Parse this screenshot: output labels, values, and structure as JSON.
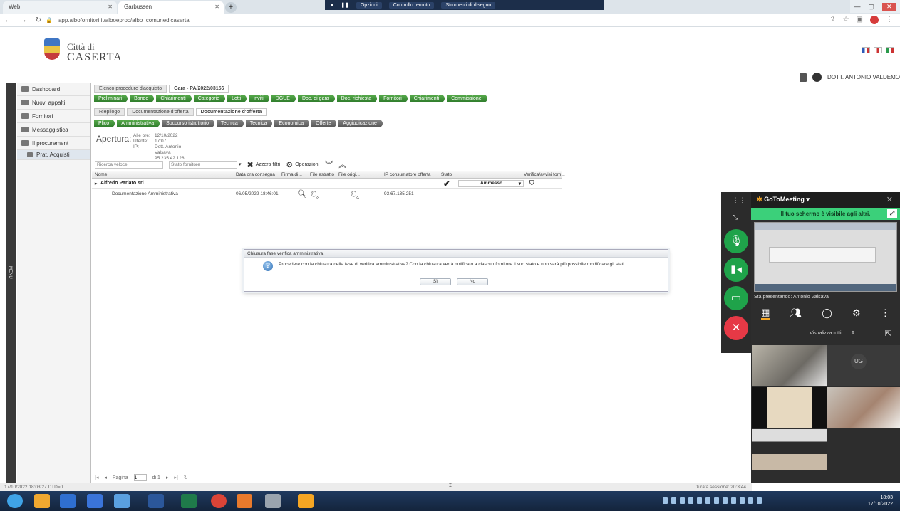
{
  "browser": {
    "tabs": [
      {
        "label": "Web"
      },
      {
        "label": "Garbussen"
      }
    ],
    "url": "app.albofornitori.it/alboeproc/albo_comunedicaserta",
    "screen_share_bar": {
      "options": "Opzioni",
      "remote_control": "Controllo remoto",
      "drawing_tools": "Strumenti di disegno"
    }
  },
  "header": {
    "brand_line1": "Città di",
    "brand_line2": "CASERTA",
    "user_name": "DOTT. ANTONIO VALDEMO"
  },
  "sidebar": {
    "items": [
      {
        "label": "Dashboard"
      },
      {
        "label": "Nuovi appalti"
      },
      {
        "label": "Fornitori"
      },
      {
        "label": "Messaggistica"
      },
      {
        "label": "Il procurement"
      }
    ],
    "sub_item": "Prat. Acquisti",
    "strip_label": "MENU"
  },
  "main": {
    "breadcrumb_tabs": [
      {
        "label": "Elenco procedure d'acquisto"
      },
      {
        "label": "Gara - PA/2022/03156"
      }
    ],
    "flow_tabs": [
      {
        "label": "Preliminari"
      },
      {
        "label": "Bando"
      },
      {
        "label": "Chiarimenti"
      },
      {
        "label": "Categorie"
      },
      {
        "label": "Lotti"
      },
      {
        "label": "Inviti"
      },
      {
        "label": "DGUE"
      },
      {
        "label": "Doc. di gara"
      },
      {
        "label": "Doc. richiesta"
      },
      {
        "label": "Fornitori"
      },
      {
        "label": "Chiarimenti"
      },
      {
        "label": "Commissione"
      }
    ],
    "section_tabs": [
      {
        "label": "Riepilogo"
      },
      {
        "label": "Documentazione d'offerta"
      },
      {
        "label": "Documentazione d'offerta"
      }
    ],
    "phase_tabs": [
      {
        "label": "Plico"
      },
      {
        "label": "Amministrativa"
      },
      {
        "label": "Soccorso istruttorio"
      },
      {
        "label": "Tecnica"
      },
      {
        "label": "Tecnica"
      },
      {
        "label": "Economica"
      },
      {
        "label": "Offerte"
      },
      {
        "label": "Aggiudicazione"
      }
    ],
    "apertura_label": "Apertura:",
    "meta": {
      "labels": [
        "Alle ore:",
        "Utente:",
        "IP:"
      ],
      "values": [
        "12/10/2022 17:07",
        "Dott. Antonio Valsava",
        "95.235.42.128"
      ]
    },
    "toolbar": {
      "search_placeholder": "Ricerca veloce",
      "filter_placeholder": "Stato fornitore",
      "clear_filters": "Azzera filtri",
      "operations": "Operazioni"
    },
    "grid": {
      "columns": [
        "Nome",
        "Data ora consegna",
        "Firma di...",
        "File estratto",
        "File origi...",
        "IP consumatore offerta",
        "Stato",
        "Verifica/avvisi forn..."
      ],
      "group_label": "Alfredo Parlato srl",
      "group_status": "Ammesso",
      "row": {
        "name": "Documentazione Amministrativa",
        "datetime": "06/05/2022 18:46:01",
        "ip": "93.67.135.251"
      }
    },
    "pager": {
      "page_label": "Pagina",
      "page_value": "1",
      "of_label": "di 1"
    }
  },
  "dialog": {
    "title": "Chiusura fase verifica amministrativa",
    "message": "Procedere con la chiusura della fase di verifica amministrativa? Con la chiusura verrà notificato a ciascun fornitore il suo stato e non sarà più possibile modificare gli stati.",
    "yes_label": "Sì",
    "no_label": "No"
  },
  "status_bar": {
    "left": "17/10/2022 18:03:27 DTD=0",
    "right": "Durata sessione: 20:3:44"
  },
  "taskbar": {
    "time": "18:03",
    "date": "17/10/2022"
  },
  "meeting": {
    "title": "GoToMeeting",
    "share_notice": "Il tuo schermo è visibile agli altri.",
    "presenter": "Sta presentando: Antonio Valsava",
    "view_all": "Visualizza tutti",
    "initials": "UG",
    "colors": {
      "mic": "#1fa34a",
      "camera": "#1fa34a",
      "screen": "#1fa34a",
      "leave": "#e63946",
      "share_banner": "#3bd07a"
    }
  }
}
